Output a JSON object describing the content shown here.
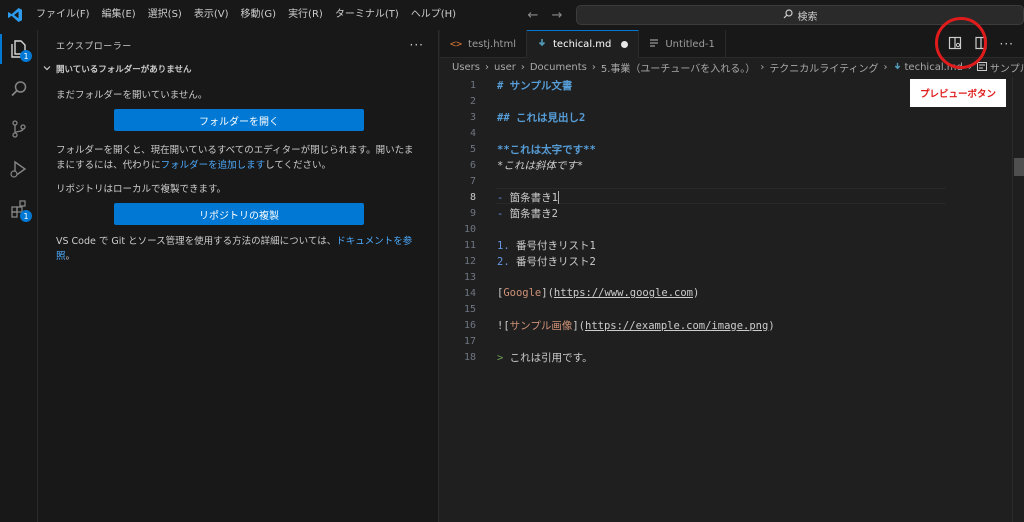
{
  "menu": [
    "ファイル(F)",
    "編集(E)",
    "選択(S)",
    "表示(V)",
    "移動(G)",
    "実行(R)",
    "ターミナル(T)",
    "ヘルプ(H)"
  ],
  "search": {
    "label": "検索"
  },
  "activity": {
    "explorer_badge": "1",
    "extensions_badge": "1"
  },
  "sidebar": {
    "title": "エクスプローラー",
    "section": "開いているフォルダーがありません",
    "msg_no_folder": "まだフォルダーを開いていません。",
    "open_folder_button": "フォルダーを開く",
    "msg_open_warning_1": "フォルダーを開くと、現在開いているすべてのエディターが閉じられます。開いたままにするには、代わりに",
    "add_folder_link": "フォルダーを追加します",
    "msg_open_warning_2": "してください。",
    "msg_clone": "リポジトリはローカルで複製できます。",
    "clone_button": "リポジトリの複製",
    "msg_git_1": "VS Code で Git とソース管理を使用する方法の詳細については、",
    "docs_link": "ドキュメントを参照",
    "msg_git_2": "。"
  },
  "tabs": [
    {
      "label": "testj.html"
    },
    {
      "label": "techical.md"
    },
    {
      "label": "Untitled-1"
    }
  ],
  "breadcrumb": [
    "Users",
    "user",
    "Documents",
    "5.事業（ユーチューバを入れる。）",
    "テクニカルライティング",
    "techical.md",
    "サンプル文書"
  ],
  "editor": {
    "line_numbers": [
      "1",
      "2",
      "3",
      "4",
      "5",
      "6",
      "7",
      "8",
      "9",
      "10",
      "11",
      "12",
      "13",
      "14",
      "15",
      "16",
      "17",
      "18"
    ],
    "current_line": 8,
    "l1": "# サンプル文書",
    "l3": "## これは見出し2",
    "l5": "**これは太字です**",
    "l6": "*これは斜体です*",
    "l8_mark": "- ",
    "l8_text": "箇条書き1",
    "l9_mark": "- ",
    "l9_text": "箇条書き2",
    "l11_mark": "1. ",
    "l11_text": "番号付きリスト1",
    "l12_mark": "2. ",
    "l12_text": "番号付きリスト2",
    "l14_open": "[",
    "l14_linktext": "Google",
    "l14_mid": "](",
    "l14_url": "https://www.google.com",
    "l14_close": ")",
    "l16_open": "![",
    "l16_linktext": "サンプル画像",
    "l16_mid": "](",
    "l16_url": "https://example.com/image.png",
    "l16_close": ")",
    "l18_mark": "> ",
    "l18_text": "これは引用です。"
  },
  "annotation": {
    "label": "プレビューボタン",
    "color": "#e01b1b"
  },
  "colors": {
    "accent": "#0078d4",
    "heading": "#569cd6",
    "link_text": "#ce9178",
    "quote": "#6a9955"
  }
}
